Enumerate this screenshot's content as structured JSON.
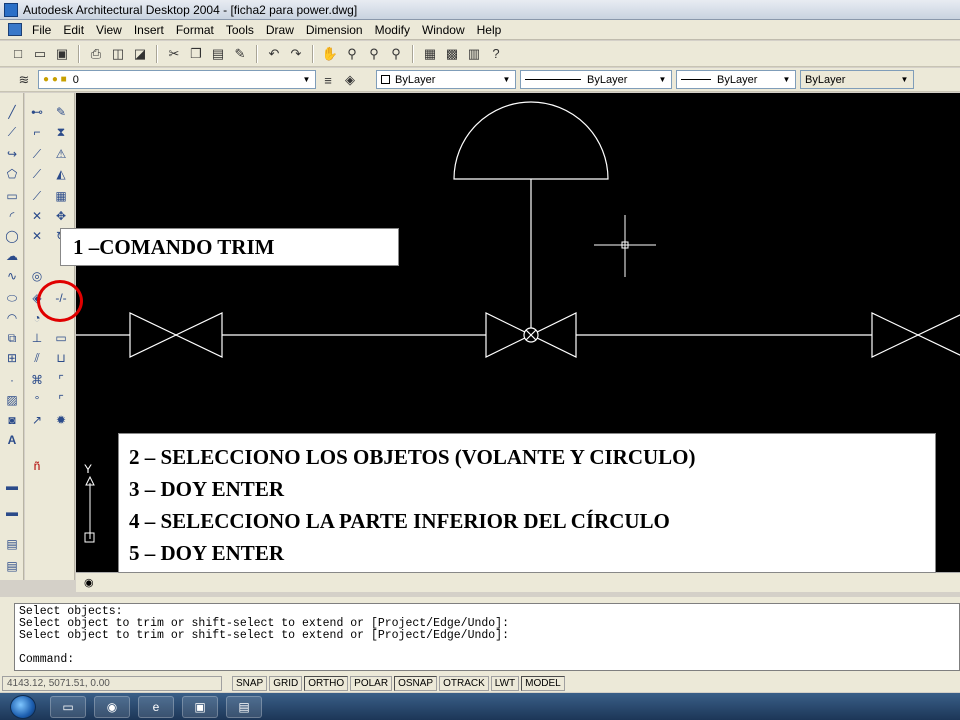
{
  "window": {
    "title": "Autodesk Architectural Desktop 2004 - [ficha2 para power.dwg]"
  },
  "menu": {
    "items": [
      "File",
      "Edit",
      "View",
      "Insert",
      "Format",
      "Tools",
      "Draw",
      "Dimension",
      "Modify",
      "Window",
      "Help"
    ]
  },
  "layers": {
    "current_layer": "0",
    "color": "ByLayer",
    "linetype": "ByLayer",
    "lineweight": "ByLayer",
    "plotstyle": "ByLayer"
  },
  "drawing": {
    "background": "#000000",
    "line_color": "#ffffff",
    "ucs_y": "Y"
  },
  "callouts": {
    "step1": "1 –COMANDO TRIM",
    "steps": [
      "2 – SELECCIONO LOS OBJETOS (VOLANTE Y CIRCULO)",
      "3 – DOY ENTER",
      "4 – SELECCIONO LA PARTE INFERIOR DEL CÍRCULO",
      "5 – DOY ENTER"
    ]
  },
  "highlight_color": "#e00000",
  "command": {
    "lines": [
      "Select objects:",
      "Select object to trim or shift-select to extend or [Project/Edge/Undo]:",
      "Select object to trim or shift-select to extend or [Project/Edge/Undo]:",
      "",
      "Command:"
    ]
  },
  "status": {
    "coords": "4143.12, 5071.51, 0.00",
    "buttons": [
      "SNAP",
      "GRID",
      "ORTHO",
      "POLAR",
      "OSNAP",
      "OTRACK",
      "LWT",
      "MODEL"
    ]
  },
  "taskbar": {
    "icons": [
      "start-orb-icon",
      "folder-icon",
      "media-icon",
      "ie-icon",
      "window-icon",
      "autocad-icon"
    ]
  }
}
